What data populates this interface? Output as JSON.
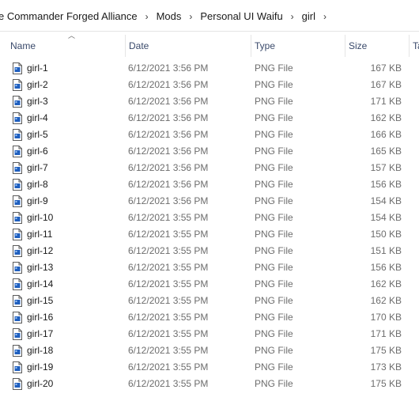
{
  "breadcrumb": {
    "items": [
      "e Commander Forged Alliance",
      "Mods",
      "Personal UI Waifu",
      "girl"
    ],
    "separator": "›"
  },
  "columns": {
    "name": "Name",
    "date": "Date",
    "type": "Type",
    "size": "Size",
    "tags": "Ta"
  },
  "files": [
    {
      "name": "girl-1",
      "date": "6/12/2021 3:56 PM",
      "type": "PNG File",
      "size": "167 KB"
    },
    {
      "name": "girl-2",
      "date": "6/12/2021 3:56 PM",
      "type": "PNG File",
      "size": "167 KB"
    },
    {
      "name": "girl-3",
      "date": "6/12/2021 3:56 PM",
      "type": "PNG File",
      "size": "171 KB"
    },
    {
      "name": "girl-4",
      "date": "6/12/2021 3:56 PM",
      "type": "PNG File",
      "size": "162 KB"
    },
    {
      "name": "girl-5",
      "date": "6/12/2021 3:56 PM",
      "type": "PNG File",
      "size": "166 KB"
    },
    {
      "name": "girl-6",
      "date": "6/12/2021 3:56 PM",
      "type": "PNG File",
      "size": "165 KB"
    },
    {
      "name": "girl-7",
      "date": "6/12/2021 3:56 PM",
      "type": "PNG File",
      "size": "157 KB"
    },
    {
      "name": "girl-8",
      "date": "6/12/2021 3:56 PM",
      "type": "PNG File",
      "size": "156 KB"
    },
    {
      "name": "girl-9",
      "date": "6/12/2021 3:56 PM",
      "type": "PNG File",
      "size": "154 KB"
    },
    {
      "name": "girl-10",
      "date": "6/12/2021 3:55 PM",
      "type": "PNG File",
      "size": "154 KB"
    },
    {
      "name": "girl-11",
      "date": "6/12/2021 3:55 PM",
      "type": "PNG File",
      "size": "150 KB"
    },
    {
      "name": "girl-12",
      "date": "6/12/2021 3:55 PM",
      "type": "PNG File",
      "size": "151 KB"
    },
    {
      "name": "girl-13",
      "date": "6/12/2021 3:55 PM",
      "type": "PNG File",
      "size": "156 KB"
    },
    {
      "name": "girl-14",
      "date": "6/12/2021 3:55 PM",
      "type": "PNG File",
      "size": "162 KB"
    },
    {
      "name": "girl-15",
      "date": "6/12/2021 3:55 PM",
      "type": "PNG File",
      "size": "162 KB"
    },
    {
      "name": "girl-16",
      "date": "6/12/2021 3:55 PM",
      "type": "PNG File",
      "size": "170 KB"
    },
    {
      "name": "girl-17",
      "date": "6/12/2021 3:55 PM",
      "type": "PNG File",
      "size": "171 KB"
    },
    {
      "name": "girl-18",
      "date": "6/12/2021 3:55 PM",
      "type": "PNG File",
      "size": "175 KB"
    },
    {
      "name": "girl-19",
      "date": "6/12/2021 3:55 PM",
      "type": "PNG File",
      "size": "173 KB"
    },
    {
      "name": "girl-20",
      "date": "6/12/2021 3:55 PM",
      "type": "PNG File",
      "size": "175 KB"
    }
  ],
  "icons": {
    "file": "image-file-icon",
    "sort": "sort-ascending-icon"
  },
  "colors": {
    "header_text": "#3a4a6b",
    "secondary_text": "#6d6d6d",
    "icon_accent": "#1f5fbf"
  }
}
